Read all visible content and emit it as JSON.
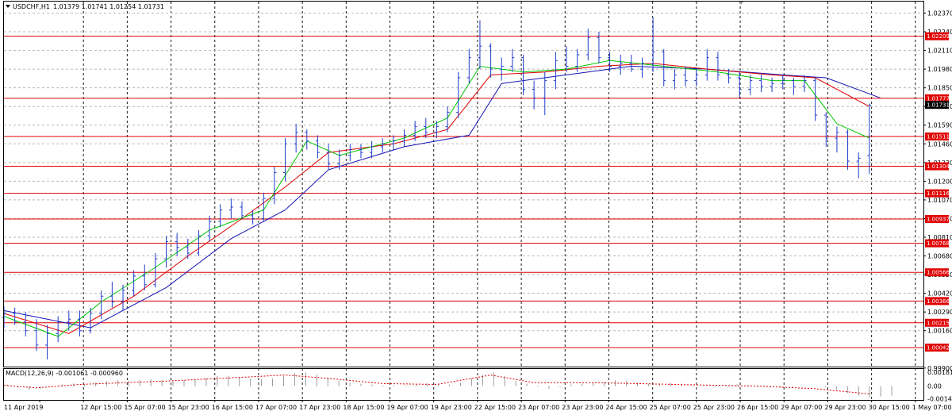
{
  "header": {
    "symbol": "USDCHF,H1",
    "ohlc": "1.01379 1.01741 1.01254 1.01731"
  },
  "macd": {
    "label": "MACD(12,26,9) -0.001061 -0.000960",
    "ticks": [
      "0.001816",
      "0.00",
      "-0.001448"
    ]
  },
  "colors": {
    "candles": "#1e3cc8",
    "level": "#e00000",
    "ma_fast": "#00c800",
    "ma_mid": "#e00000",
    "ma_slow": "#1414b4",
    "macd_hist": "#9a9a9a",
    "macd_signal": "#e00000"
  },
  "chart_data": {
    "type": "candlestick",
    "x_ticks": [
      "11 Apr 2019",
      "12 Apr 15:00",
      "15 Apr 07:00",
      "15 Apr 23:00",
      "16 Apr 15:00",
      "17 Apr 07:00",
      "17 Apr 23:00",
      "18 Apr 15:00",
      "19 Apr 07:00",
      "19 Apr 23:00",
      "22 Apr 15:00",
      "23 Apr 07:00",
      "23 Apr 23:00",
      "24 Apr 15:00",
      "25 Apr 07:00",
      "25 Apr 23:00",
      "26 Apr 15:00",
      "29 Apr 07:00",
      "29 Apr 23:00",
      "30 Apr 15:00",
      "1 May 07:00"
    ],
    "y_ticks": [
      "1.02370",
      "1.02240",
      "1.02110",
      "1.01980",
      "1.01850",
      "1.01720",
      "1.01590",
      "1.01460",
      "1.01330",
      "1.01200",
      "1.01070",
      "1.00940",
      "1.00810",
      "1.00680",
      "1.00550",
      "1.00420",
      "1.00290",
      "1.00160",
      "0.99900"
    ],
    "ylim": [
      0.9991,
      1.0245
    ],
    "levels": [
      "1.02209",
      "1.01777",
      "1.01511",
      "1.01304",
      "1.01116",
      "1.00937",
      "1.00768",
      "1.00566",
      "1.00366",
      "1.00215",
      "1.00042"
    ],
    "current_price": "1.01731",
    "candles": [
      {
        "t": 0,
        "o": 1.0025,
        "h": 1.0033,
        "l": 1.0018,
        "c": 1.0028
      },
      {
        "t": 2,
        "o": 1.0028,
        "h": 1.0032,
        "l": 1.002,
        "c": 1.0022
      },
      {
        "t": 4,
        "o": 1.0022,
        "h": 1.0029,
        "l": 1.0012,
        "c": 1.0016
      },
      {
        "t": 6,
        "o": 1.0016,
        "h": 1.0024,
        "l": 1.0002,
        "c": 1.0006
      },
      {
        "t": 8,
        "o": 1.0006,
        "h": 1.002,
        "l": 0.9996,
        "c": 1.0014
      },
      {
        "t": 10,
        "o": 1.0014,
        "h": 1.0026,
        "l": 1.0008,
        "c": 1.0022
      },
      {
        "t": 12,
        "o": 1.0022,
        "h": 1.003,
        "l": 1.0016,
        "c": 1.0024
      },
      {
        "t": 14,
        "o": 1.0024,
        "h": 1.003,
        "l": 1.0012,
        "c": 1.0016
      },
      {
        "t": 16,
        "o": 1.0016,
        "h": 1.0032,
        "l": 1.0014,
        "c": 1.0028
      },
      {
        "t": 18,
        "o": 1.0028,
        "h": 1.0044,
        "l": 1.0024,
        "c": 1.004
      },
      {
        "t": 20,
        "o": 1.004,
        "h": 1.005,
        "l": 1.0032,
        "c": 1.0036
      },
      {
        "t": 22,
        "o": 1.0036,
        "h": 1.0048,
        "l": 1.003,
        "c": 1.0044
      },
      {
        "t": 24,
        "o": 1.0044,
        "h": 1.0058,
        "l": 1.004,
        "c": 1.0054
      },
      {
        "t": 26,
        "o": 1.0054,
        "h": 1.0062,
        "l": 1.0044,
        "c": 1.0048
      },
      {
        "t": 28,
        "o": 1.0048,
        "h": 1.007,
        "l": 1.0046,
        "c": 1.0066
      },
      {
        "t": 30,
        "o": 1.0066,
        "h": 1.0082,
        "l": 1.006,
        "c": 1.0078
      },
      {
        "t": 32,
        "o": 1.0078,
        "h": 1.0084,
        "l": 1.0068,
        "c": 1.0074
      },
      {
        "t": 34,
        "o": 1.0074,
        "h": 1.008,
        "l": 1.0066,
        "c": 1.007
      },
      {
        "t": 36,
        "o": 1.007,
        "h": 1.0086,
        "l": 1.0068,
        "c": 1.0082
      },
      {
        "t": 38,
        "o": 1.0082,
        "h": 1.0096,
        "l": 1.0078,
        "c": 1.0092
      },
      {
        "t": 40,
        "o": 1.0092,
        "h": 1.0104,
        "l": 1.0088,
        "c": 1.01
      },
      {
        "t": 42,
        "o": 1.01,
        "h": 1.0108,
        "l": 1.0094,
        "c": 1.0102
      },
      {
        "t": 44,
        "o": 1.0102,
        "h": 1.0106,
        "l": 1.0094,
        "c": 1.0096
      },
      {
        "t": 46,
        "o": 1.0096,
        "h": 1.01,
        "l": 1.009,
        "c": 1.0094
      },
      {
        "t": 48,
        "o": 1.0094,
        "h": 1.0112,
        "l": 1.0092,
        "c": 1.0108
      },
      {
        "t": 50,
        "o": 1.0108,
        "h": 1.013,
        "l": 1.0104,
        "c": 1.0126
      },
      {
        "t": 52,
        "o": 1.0126,
        "h": 1.015,
        "l": 1.012,
        "c": 1.0146
      },
      {
        "t": 54,
        "o": 1.0146,
        "h": 1.016,
        "l": 1.014,
        "c": 1.0154
      },
      {
        "t": 56,
        "o": 1.0154,
        "h": 1.0156,
        "l": 1.0142,
        "c": 1.0148
      },
      {
        "t": 58,
        "o": 1.0148,
        "h": 1.0152,
        "l": 1.0136,
        "c": 1.014
      },
      {
        "t": 60,
        "o": 1.014,
        "h": 1.0146,
        "l": 1.0128,
        "c": 1.0132
      },
      {
        "t": 62,
        "o": 1.0132,
        "h": 1.0142,
        "l": 1.0128,
        "c": 1.0138
      },
      {
        "t": 64,
        "o": 1.0138,
        "h": 1.0146,
        "l": 1.0134,
        "c": 1.0142
      },
      {
        "t": 66,
        "o": 1.0142,
        "h": 1.0146,
        "l": 1.0136,
        "c": 1.014
      },
      {
        "t": 68,
        "o": 1.014,
        "h": 1.0148,
        "l": 1.0136,
        "c": 1.0144
      },
      {
        "t": 70,
        "o": 1.0144,
        "h": 1.015,
        "l": 1.014,
        "c": 1.0146
      },
      {
        "t": 72,
        "o": 1.0146,
        "h": 1.0152,
        "l": 1.0142,
        "c": 1.0148
      },
      {
        "t": 74,
        "o": 1.0148,
        "h": 1.0156,
        "l": 1.0144,
        "c": 1.0152
      },
      {
        "t": 76,
        "o": 1.0152,
        "h": 1.0162,
        "l": 1.0148,
        "c": 1.0158
      },
      {
        "t": 78,
        "o": 1.0158,
        "h": 1.0164,
        "l": 1.015,
        "c": 1.0154
      },
      {
        "t": 80,
        "o": 1.0154,
        "h": 1.0162,
        "l": 1.015,
        "c": 1.0158
      },
      {
        "t": 82,
        "o": 1.0158,
        "h": 1.0172,
        "l": 1.0154,
        "c": 1.0168
      },
      {
        "t": 84,
        "o": 1.0168,
        "h": 1.0196,
        "l": 1.0164,
        "c": 1.0192
      },
      {
        "t": 86,
        "o": 1.0192,
        "h": 1.0212,
        "l": 1.0188,
        "c": 1.0206
      },
      {
        "t": 88,
        "o": 1.0206,
        "h": 1.0232,
        "l": 1.0198,
        "c": 1.0214
      },
      {
        "t": 90,
        "o": 1.0214,
        "h": 1.0216,
        "l": 1.0192,
        "c": 1.0198
      },
      {
        "t": 92,
        "o": 1.0198,
        "h": 1.0206,
        "l": 1.019,
        "c": 1.02
      },
      {
        "t": 94,
        "o": 1.02,
        "h": 1.0212,
        "l": 1.0196,
        "c": 1.0206
      },
      {
        "t": 96,
        "o": 1.0206,
        "h": 1.0208,
        "l": 1.018,
        "c": 1.0184
      },
      {
        "t": 98,
        "o": 1.0184,
        "h": 1.019,
        "l": 1.017,
        "c": 1.0178
      },
      {
        "t": 100,
        "o": 1.0178,
        "h": 1.0196,
        "l": 1.0166,
        "c": 1.019
      },
      {
        "t": 102,
        "o": 1.019,
        "h": 1.021,
        "l": 1.0184,
        "c": 1.0204
      },
      {
        "t": 104,
        "o": 1.0204,
        "h": 1.0214,
        "l": 1.0196,
        "c": 1.02
      },
      {
        "t": 106,
        "o": 1.02,
        "h": 1.0212,
        "l": 1.0196,
        "c": 1.0208
      },
      {
        "t": 108,
        "o": 1.0208,
        "h": 1.0226,
        "l": 1.0204,
        "c": 1.022
      },
      {
        "t": 110,
        "o": 1.022,
        "h": 1.0224,
        "l": 1.0202,
        "c": 1.0206
      },
      {
        "t": 112,
        "o": 1.0206,
        "h": 1.021,
        "l": 1.0196,
        "c": 1.02
      },
      {
        "t": 114,
        "o": 1.02,
        "h": 1.0208,
        "l": 1.0194,
        "c": 1.0202
      },
      {
        "t": 116,
        "o": 1.0202,
        "h": 1.0208,
        "l": 1.0196,
        "c": 1.0198
      },
      {
        "t": 118,
        "o": 1.0198,
        "h": 1.0206,
        "l": 1.0192,
        "c": 1.0202
      },
      {
        "t": 120,
        "o": 1.0202,
        "h": 1.0234,
        "l": 1.0196,
        "c": 1.021
      },
      {
        "t": 122,
        "o": 1.021,
        "h": 1.0212,
        "l": 1.0186,
        "c": 1.019
      },
      {
        "t": 124,
        "o": 1.019,
        "h": 1.0198,
        "l": 1.0184,
        "c": 1.0194
      },
      {
        "t": 126,
        "o": 1.0194,
        "h": 1.02,
        "l": 1.0186,
        "c": 1.019
      },
      {
        "t": 128,
        "o": 1.019,
        "h": 1.0198,
        "l": 1.0186,
        "c": 1.0194
      },
      {
        "t": 130,
        "o": 1.0194,
        "h": 1.0212,
        "l": 1.019,
        "c": 1.0206
      },
      {
        "t": 132,
        "o": 1.0206,
        "h": 1.021,
        "l": 1.019,
        "c": 1.0194
      },
      {
        "t": 134,
        "o": 1.0194,
        "h": 1.0198,
        "l": 1.0188,
        "c": 1.0192
      },
      {
        "t": 136,
        "o": 1.0192,
        "h": 1.0196,
        "l": 1.0178,
        "c": 1.0184
      },
      {
        "t": 138,
        "o": 1.0184,
        "h": 1.0194,
        "l": 1.018,
        "c": 1.019
      },
      {
        "t": 140,
        "o": 1.019,
        "h": 1.0194,
        "l": 1.0182,
        "c": 1.0186
      },
      {
        "t": 142,
        "o": 1.0186,
        "h": 1.0192,
        "l": 1.0182,
        "c": 1.0188
      },
      {
        "t": 144,
        "o": 1.0188,
        "h": 1.0194,
        "l": 1.0184,
        "c": 1.019
      },
      {
        "t": 146,
        "o": 1.019,
        "h": 1.0192,
        "l": 1.018,
        "c": 1.0186
      },
      {
        "t": 148,
        "o": 1.0186,
        "h": 1.0194,
        "l": 1.0182,
        "c": 1.019
      },
      {
        "t": 150,
        "o": 1.019,
        "h": 1.0192,
        "l": 1.0162,
        "c": 1.0166
      },
      {
        "t": 152,
        "o": 1.0166,
        "h": 1.0168,
        "l": 1.0144,
        "c": 1.015
      },
      {
        "t": 154,
        "o": 1.015,
        "h": 1.0158,
        "l": 1.014,
        "c": 1.0154
      },
      {
        "t": 156,
        "o": 1.0154,
        "h": 1.0156,
        "l": 1.0128,
        "c": 1.0134
      },
      {
        "t": 158,
        "o": 1.0134,
        "h": 1.014,
        "l": 1.0122,
        "c": 1.0136
      },
      {
        "t": 160,
        "o": 1.0138,
        "h": 1.0174,
        "l": 1.0125,
        "c": 1.0173
      }
    ],
    "ma_fast": [
      [
        0,
        1.0026
      ],
      [
        10,
        1.0012
      ],
      [
        18,
        1.0036
      ],
      [
        28,
        1.006
      ],
      [
        38,
        1.0086
      ],
      [
        48,
        1.01
      ],
      [
        56,
        1.0148
      ],
      [
        62,
        1.0138
      ],
      [
        74,
        1.015
      ],
      [
        82,
        1.0164
      ],
      [
        88,
        1.02
      ],
      [
        96,
        1.0196
      ],
      [
        104,
        1.0198
      ],
      [
        112,
        1.0204
      ],
      [
        122,
        1.02
      ],
      [
        132,
        1.0196
      ],
      [
        142,
        1.019
      ],
      [
        148,
        1.019
      ],
      [
        154,
        1.016
      ],
      [
        160,
        1.015
      ]
    ],
    "ma_mid": [
      [
        0,
        1.0028
      ],
      [
        12,
        1.0014
      ],
      [
        24,
        1.004
      ],
      [
        34,
        1.0068
      ],
      [
        44,
        1.0094
      ],
      [
        52,
        1.0116
      ],
      [
        60,
        1.014
      ],
      [
        72,
        1.0146
      ],
      [
        82,
        1.0156
      ],
      [
        90,
        1.0194
      ],
      [
        100,
        1.0196
      ],
      [
        110,
        1.02
      ],
      [
        120,
        1.0202
      ],
      [
        130,
        1.0198
      ],
      [
        142,
        1.0194
      ],
      [
        150,
        1.0192
      ],
      [
        160,
        1.0172
      ]
    ],
    "ma_slow": [
      [
        0,
        1.003
      ],
      [
        16,
        1.0018
      ],
      [
        30,
        1.0046
      ],
      [
        42,
        1.008
      ],
      [
        52,
        1.01
      ],
      [
        60,
        1.0128
      ],
      [
        74,
        1.0144
      ],
      [
        86,
        1.0152
      ],
      [
        92,
        1.0188
      ],
      [
        104,
        1.0194
      ],
      [
        116,
        1.02
      ],
      [
        130,
        1.0198
      ],
      [
        144,
        1.0194
      ],
      [
        152,
        1.0192
      ],
      [
        162,
        1.0178
      ]
    ],
    "macd_hist": [
      0.0002,
      -0.0002,
      -0.0004,
      -0.0003,
      0.0,
      0.0002,
      0.0003,
      0.0002,
      0.0004,
      0.0006,
      0.0007,
      0.0006,
      0.0007,
      0.0008,
      0.0007,
      0.0006,
      0.0007,
      0.0008,
      0.001,
      0.0012,
      0.0012,
      0.0011,
      0.0009,
      0.0008,
      0.0009,
      0.0012,
      0.0015,
      0.0016,
      0.0014,
      0.001,
      0.0006,
      0.0004,
      0.0003,
      0.0002,
      0.0001,
      0.0001,
      0.0001,
      0.0002,
      0.0003,
      0.0002,
      0.0002,
      0.0004,
      0.0009,
      0.0013,
      0.0016,
      0.0012,
      0.0006,
      0.0003,
      -0.0001,
      -0.0003,
      -0.0001,
      0.0002,
      0.0003,
      0.0004,
      0.0005,
      0.0007,
      0.0006,
      0.0004,
      0.0003,
      0.0002,
      0.0004,
      0.0003,
      0.0001,
      0.0,
      -0.0001,
      0.0001,
      0.0002,
      0.0001,
      -0.0001,
      -0.0002,
      -0.0001,
      -0.0001,
      0.0,
      0.0,
      -0.0001,
      -0.0004,
      -0.0008,
      -0.0011,
      -0.0013,
      -0.0012,
      -0.0011
    ],
    "macd_signal": [
      [
        0,
        0.0001
      ],
      [
        6,
        -0.0002
      ],
      [
        14,
        0.0002
      ],
      [
        30,
        0.0006
      ],
      [
        40,
        0.0009
      ],
      [
        52,
        0.0013
      ],
      [
        60,
        0.0009
      ],
      [
        70,
        0.0003
      ],
      [
        80,
        0.0002
      ],
      [
        90,
        0.0013
      ],
      [
        98,
        0.0004
      ],
      [
        110,
        0.0004
      ],
      [
        124,
        0.0002
      ],
      [
        140,
        0.0
      ],
      [
        150,
        -0.0003
      ],
      [
        160,
        -0.0009
      ]
    ]
  }
}
